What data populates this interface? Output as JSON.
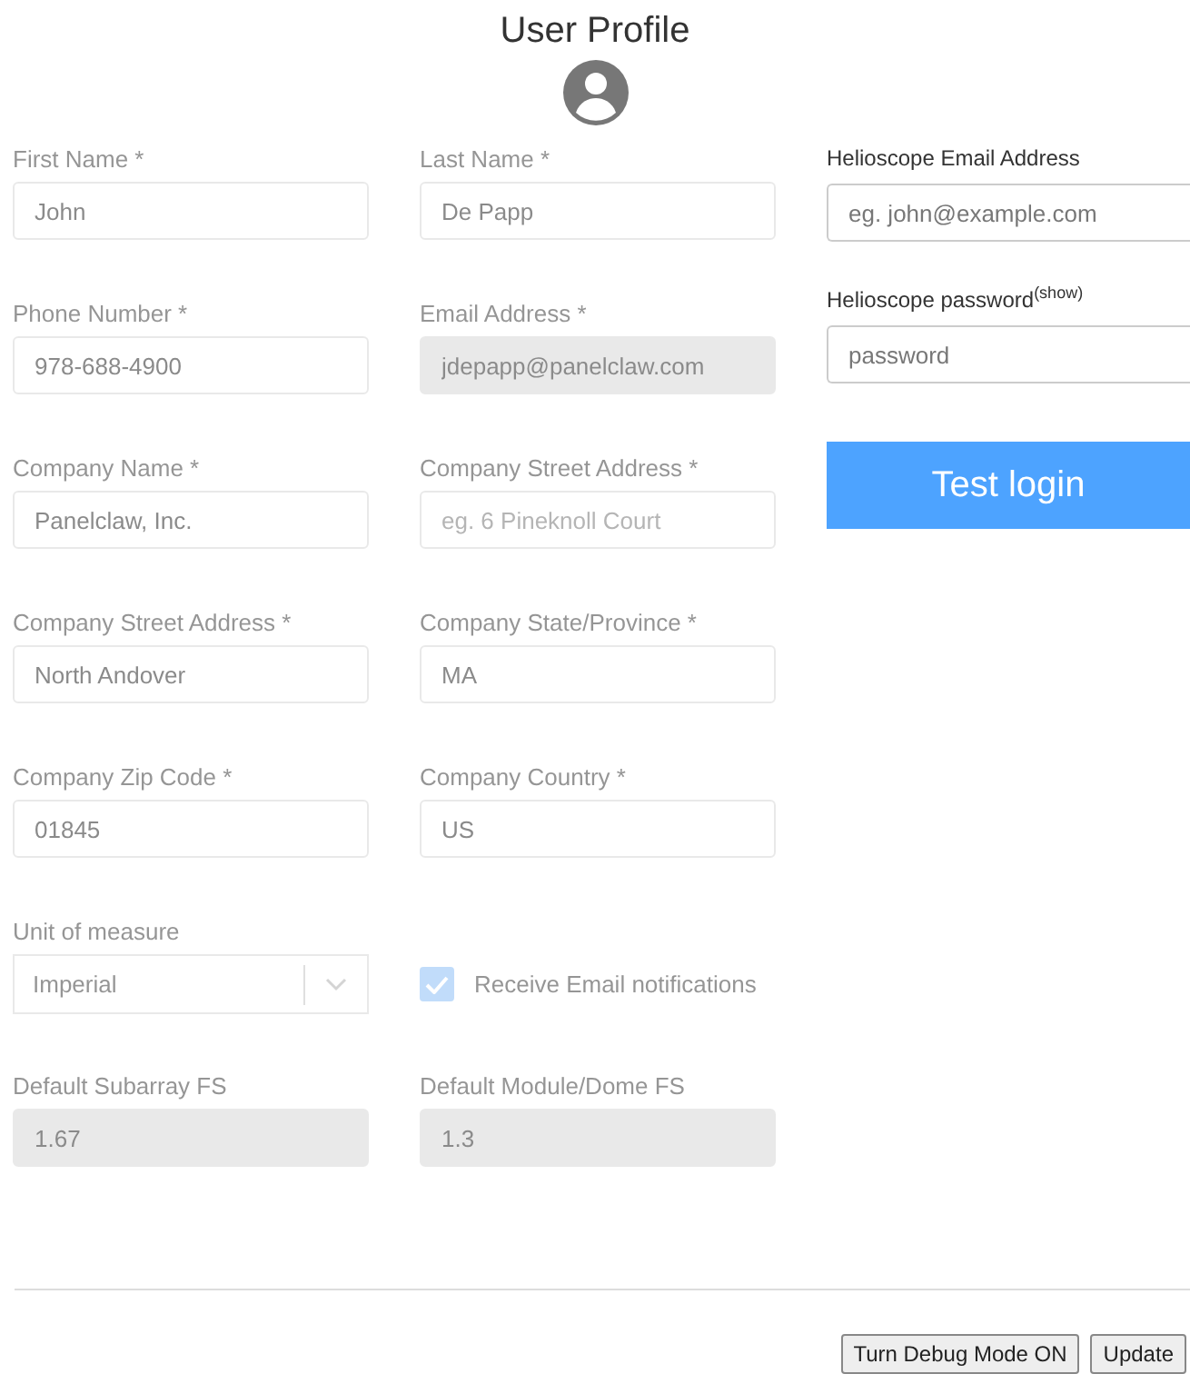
{
  "title": "User Profile",
  "form": {
    "faded": true,
    "fields": [
      {
        "kind": "text",
        "label": "First Name *",
        "value": "John",
        "disabled": false
      },
      {
        "kind": "text",
        "label": "Last Name *",
        "value": "De Papp",
        "disabled": false
      },
      {
        "kind": "text",
        "label": "Phone Number *",
        "value": "978-688-4900",
        "disabled": false
      },
      {
        "kind": "text",
        "label": "Email Address *",
        "value": "jdepapp@panelclaw.com",
        "disabled": true
      },
      {
        "kind": "text",
        "label": "Company Name *",
        "value": "Panelclaw, Inc.",
        "disabled": false
      },
      {
        "kind": "text",
        "label": "Company Street Address *",
        "placeholder": "eg. 6 Pineknoll Court",
        "disabled": false
      },
      {
        "kind": "text",
        "label": "Company Street Address *",
        "value": "North Andover",
        "disabled": false
      },
      {
        "kind": "text",
        "label": "Company State/Province *",
        "value": "MA",
        "disabled": false
      },
      {
        "kind": "text",
        "label": "Company Zip Code *",
        "value": "01845",
        "disabled": false
      },
      {
        "kind": "text",
        "label": "Company Country *",
        "value": "US",
        "disabled": false
      },
      {
        "kind": "select",
        "label": "Unit of measure",
        "value": "Imperial",
        "disabled": false
      },
      {
        "kind": "checkbox",
        "label": "Receive Email notifications",
        "checked": true,
        "disabled": false
      },
      {
        "kind": "text",
        "label": "Default Subarray FS",
        "value": "1.67",
        "disabled": true
      },
      {
        "kind": "text",
        "label": "Default Module/Dome FS",
        "value": "1.3",
        "disabled": true
      }
    ]
  },
  "helioscope": {
    "email_label": "Helioscope Email Address",
    "email_placeholder": "eg. john@example.com",
    "password_label": "Helioscope password",
    "show_link": "(show)",
    "password_placeholder": "password",
    "test_button": "Test login"
  },
  "buttons": [
    "Turn Debug Mode ON",
    "Update"
  ]
}
